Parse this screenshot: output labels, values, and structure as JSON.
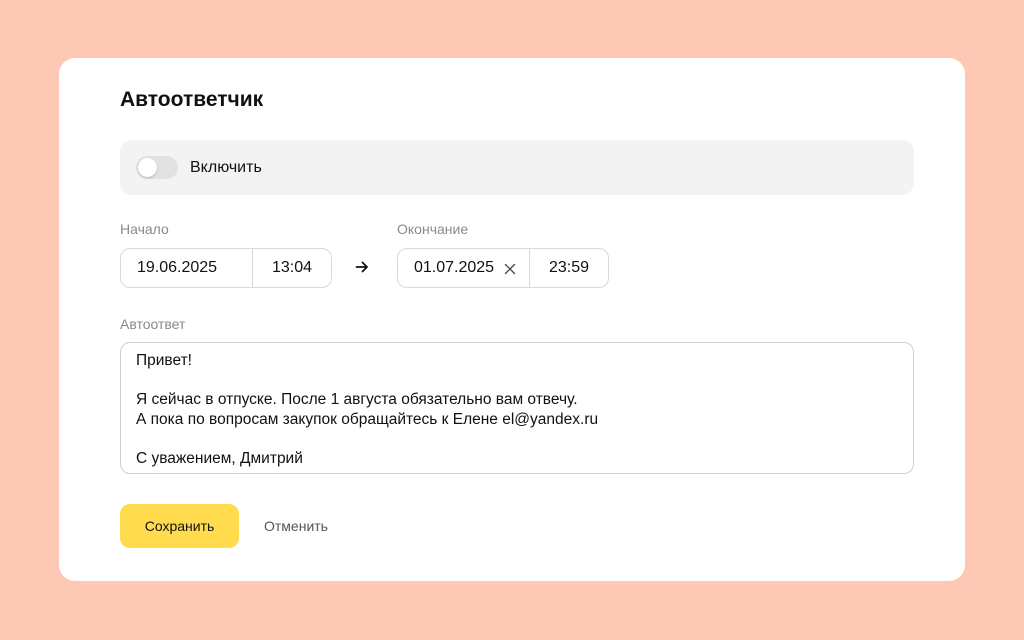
{
  "autoreply": {
    "title": "Автоответчик",
    "enable_label": "Включить",
    "enabled": false,
    "start": {
      "label": "Начало",
      "date": "19.06.2025",
      "time": "13:04"
    },
    "end": {
      "label": "Окончание",
      "date": "01.07.2025",
      "time": "23:59"
    },
    "message": {
      "label": "Автоответ",
      "lines": [
        "Привет!",
        "",
        "Я сейчас в отпуске. После 1 августа обязательно вам отвечу.",
        "А пока по вопросам закупок обращайтесь к Елене el@yandex.ru",
        "",
        "С уважением, Дмитрий"
      ]
    },
    "save_label": "Сохранить",
    "cancel_label": "Отменить"
  },
  "icons": {
    "arrow": "arrow-right-icon",
    "clear": "close-icon"
  },
  "colors": {
    "page_background": "#fdc8b4",
    "card_background": "#ffffff",
    "save_button": "#ffdb4d",
    "toggle_row": "#f3f3f3"
  }
}
